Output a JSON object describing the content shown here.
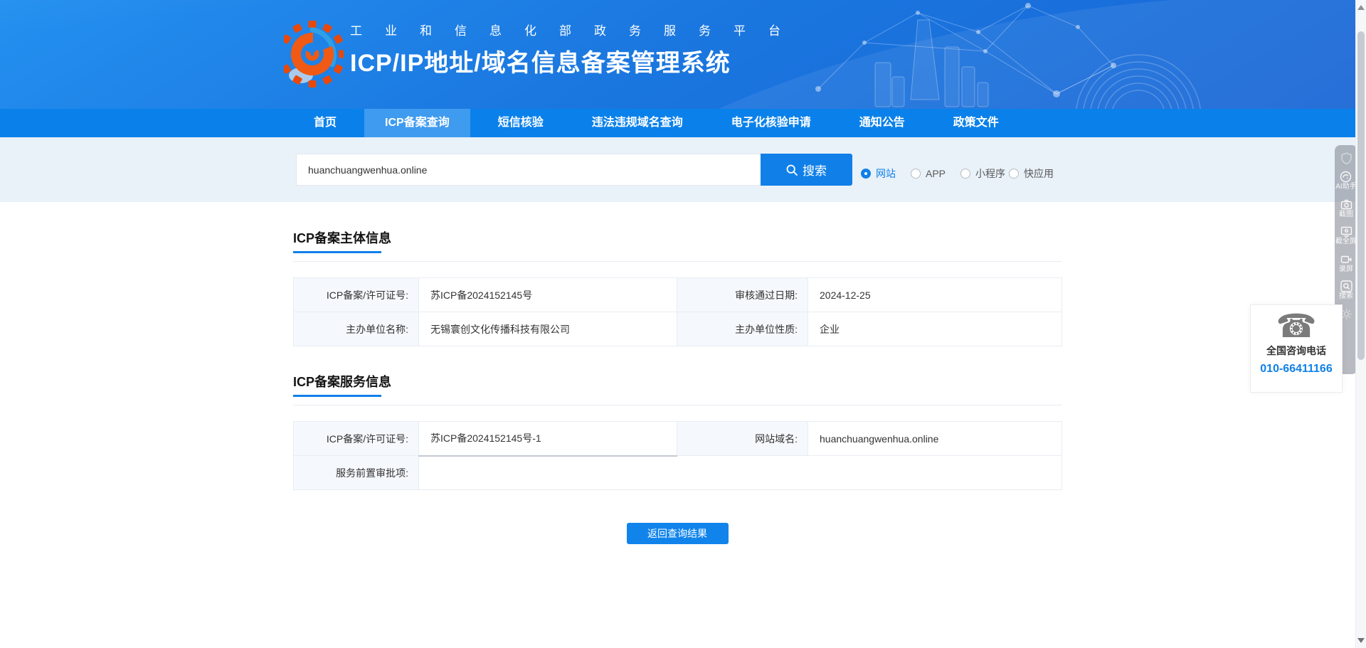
{
  "header": {
    "ministry_title": "工业和信息化部政务服务平台",
    "system_title": "ICP/IP地址/域名信息备案管理系统"
  },
  "nav": {
    "items": [
      {
        "label": "首页",
        "active": false
      },
      {
        "label": "ICP备案查询",
        "active": true
      },
      {
        "label": "短信核验",
        "active": false
      },
      {
        "label": "违法违规域名查询",
        "active": false
      },
      {
        "label": "电子化核验申请",
        "active": false
      },
      {
        "label": "通知公告",
        "active": false
      },
      {
        "label": "政策文件",
        "active": false
      }
    ]
  },
  "search": {
    "value": "huanchuangwenhua.online",
    "button_label": "搜索",
    "types": [
      {
        "label": "网站",
        "selected": true
      },
      {
        "label": "APP",
        "selected": false
      },
      {
        "label": "小程序",
        "selected": false
      },
      {
        "label": "快应用",
        "selected": false
      }
    ]
  },
  "subject_section": {
    "title": "ICP备案主体信息",
    "rows": [
      {
        "c0": "ICP备案/许可证号:",
        "c1": "苏ICP备2024152145号",
        "c2": "审核通过日期:",
        "c3": "2024-12-25"
      },
      {
        "c0": "主办单位名称:",
        "c1": "无锡寰创文化传播科技有限公司",
        "c2": "主办单位性质:",
        "c3": "企业"
      }
    ]
  },
  "service_section": {
    "title": "ICP备案服务信息",
    "rows": [
      {
        "c0": "ICP备案/许可证号:",
        "c1": "苏ICP备2024152145号-1",
        "c2": "网站域名:",
        "c3": "huanchuangwenhua.online"
      },
      {
        "c0": "服务前置审批项:",
        "c1": ""
      }
    ]
  },
  "back_button_label": "返回查询结果",
  "contact": {
    "title": "全国咨询电话",
    "phone": "010-66411166"
  },
  "side_toolbar": {
    "items": [
      {
        "icon": "shield-icon",
        "label": ""
      },
      {
        "icon": "ai-assistant-icon",
        "label": "AI助手"
      },
      {
        "icon": "screenshot-icon",
        "label": "截图"
      },
      {
        "icon": "fullscreen-capture-icon",
        "label": "截全屏"
      },
      {
        "icon": "screen-record-icon",
        "label": "录屏"
      },
      {
        "icon": "search-tool-icon",
        "label": "搜索"
      },
      {
        "icon": "settings-icon",
        "label": ""
      }
    ]
  },
  "colors": {
    "accent": "#1080e8",
    "nav": "#0a81ea",
    "nav_active": "#3f9bef",
    "search_section_bg": "#e9f1f9",
    "label_cell_bg": "#f5f8fc"
  }
}
